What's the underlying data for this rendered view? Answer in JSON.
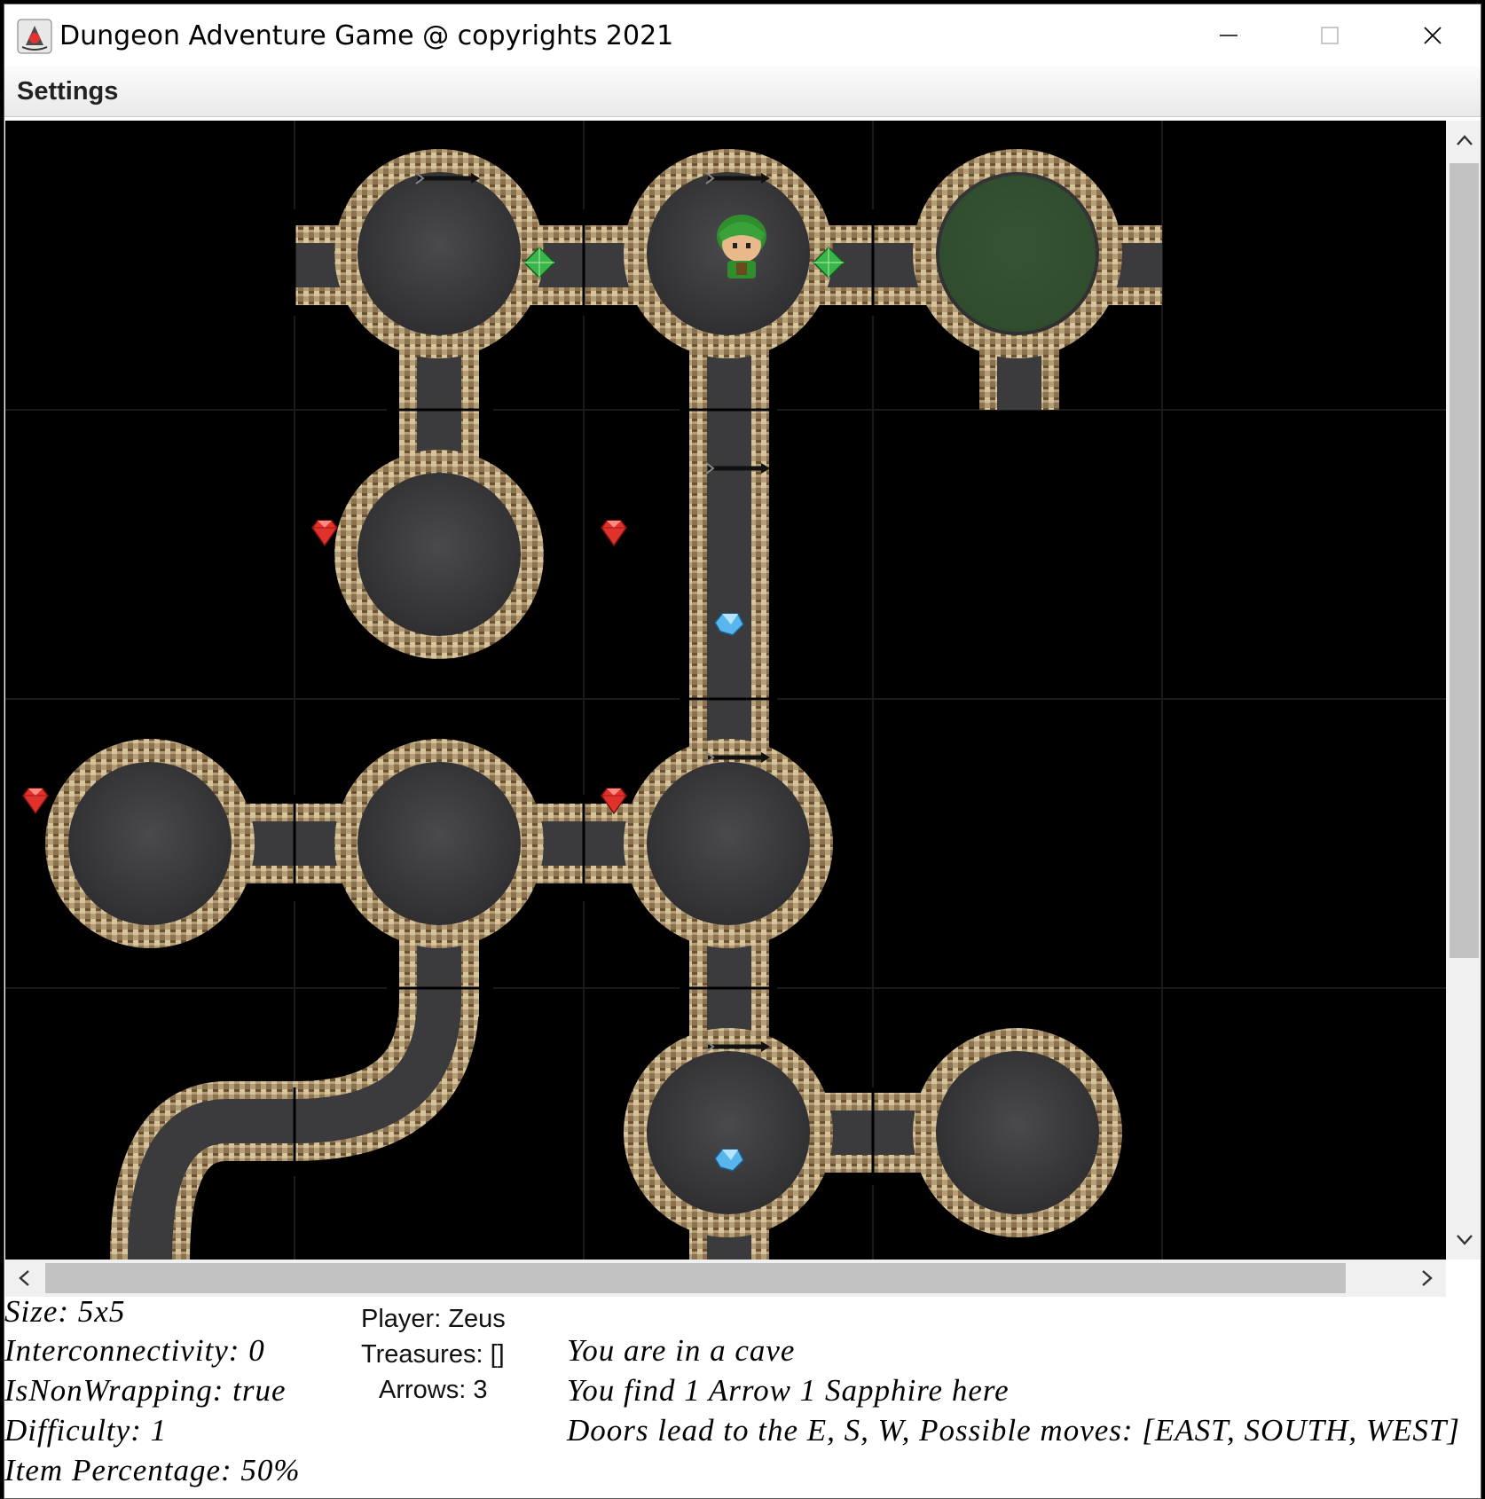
{
  "window": {
    "title": "Dungeon Adventure Game @ copyrights 2021",
    "app_icon": "java-icon",
    "controls": [
      "minimize-icon",
      "maximize-icon",
      "close-icon"
    ]
  },
  "menu": {
    "settings_label": "Settings"
  },
  "map": {
    "grid_size": [
      5,
      5
    ],
    "colors": {
      "floor": "#3b3b3d",
      "wall_light": "#c9b58c",
      "wall_dark": "#6b5232",
      "background": "#000000"
    },
    "rooms": [
      {
        "row": 0,
        "col": 1,
        "type": "cave",
        "exits": [
          "E",
          "S"
        ],
        "items": [
          "arrow",
          "emerald-east"
        ]
      },
      {
        "row": 0,
        "col": 2,
        "type": "cave",
        "exits": [
          "E",
          "S",
          "W"
        ],
        "items": [
          "arrow",
          "player",
          "emerald-east"
        ]
      },
      {
        "row": 0,
        "col": 3,
        "type": "cave",
        "exits": [
          "S",
          "W"
        ],
        "items": [
          "green-smell"
        ]
      },
      {
        "row": 1,
        "col": 1,
        "type": "cave",
        "exits": [
          "N"
        ],
        "items": [
          "ruby-west"
        ]
      },
      {
        "row": 1,
        "col": 2,
        "type": "tunnel",
        "exits": [
          "N",
          "S"
        ],
        "items": [
          "arrow",
          "ruby-left",
          "sapphire"
        ]
      },
      {
        "row": 2,
        "col": 0,
        "type": "cave",
        "exits": [
          "E"
        ],
        "items": [
          "ruby-west"
        ]
      },
      {
        "row": 2,
        "col": 1,
        "type": "cave",
        "exits": [
          "E",
          "S",
          "W"
        ],
        "items": []
      },
      {
        "row": 2,
        "col": 2,
        "type": "cave",
        "exits": [
          "N",
          "S",
          "W"
        ],
        "items": [
          "arrow",
          "ruby-west"
        ]
      },
      {
        "row": 3,
        "col": 0,
        "type": "tunnel",
        "exits": [
          "E",
          "S"
        ],
        "items": []
      },
      {
        "row": 3,
        "col": 1,
        "type": "tunnel",
        "exits": [
          "N",
          "W"
        ],
        "items": []
      },
      {
        "row": 3,
        "col": 2,
        "type": "cave",
        "exits": [
          "N",
          "E",
          "S"
        ],
        "items": [
          "arrow",
          "sapphire"
        ]
      },
      {
        "row": 3,
        "col": 3,
        "type": "cave",
        "exits": [
          "W"
        ],
        "items": []
      }
    ]
  },
  "status": {
    "size": "Size:  5x5",
    "interconnectivity": "Interconnectivity:  0",
    "non_wrapping": "IsNonWrapping:  true",
    "difficulty": "Difficulty:  1",
    "item_percentage": "Item Percentage:  50%",
    "player": "Player: Zeus",
    "treasures": "Treasures: []",
    "arrows": "Arrows: 3",
    "message_1": "You are in a cave",
    "message_2": "You find 1 Arrow 1 Sapphire here",
    "message_3": "Doors lead to the E, S, W, Possible moves: [EAST, SOUTH, WEST]"
  }
}
